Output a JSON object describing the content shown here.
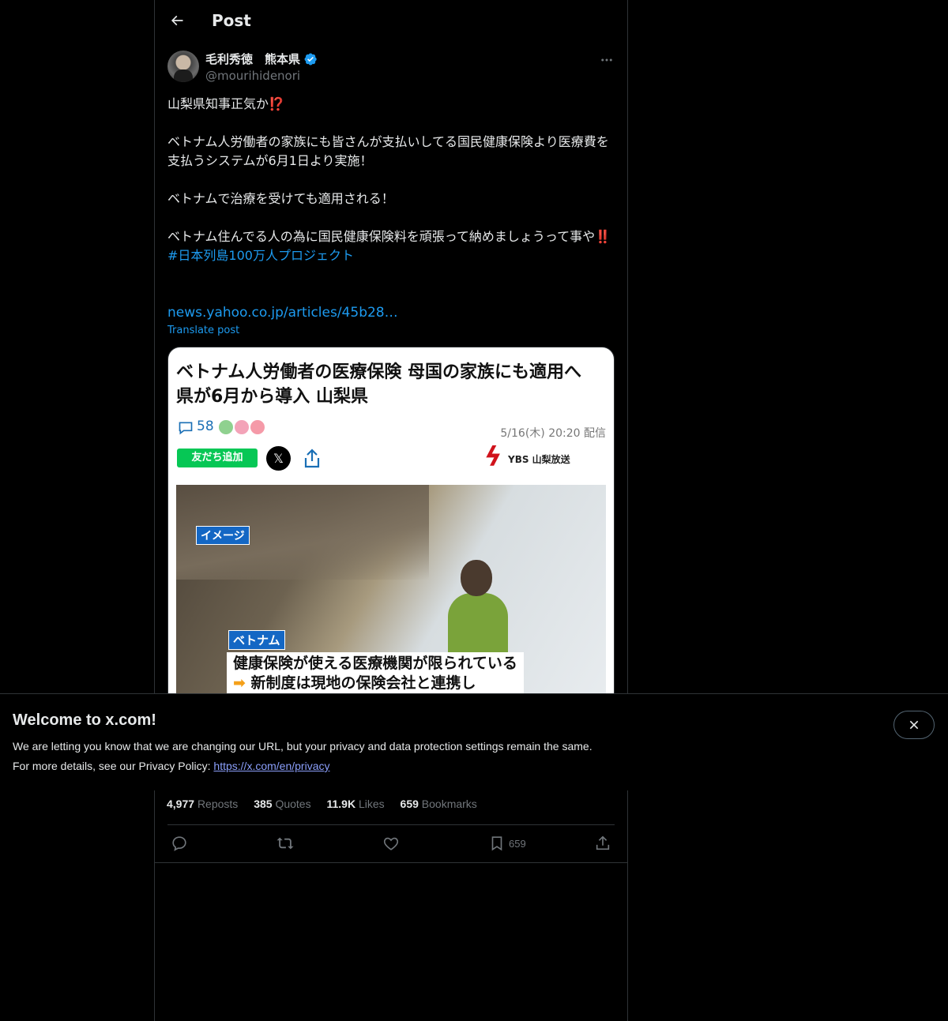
{
  "header": {
    "title": "Post"
  },
  "author": {
    "display_name": "毛利秀徳　熊本県",
    "handle": "@mourihidenori",
    "verified": true
  },
  "post": {
    "line1": "山梨県知事正気か",
    "line1_emoji": "⁉️",
    "para2": "ベトナム人労働者の家族にも皆さんが支払いしてる国民健康保険より医療費を支払うシステムが6月1日より実施！",
    "para3": "ベトナムで治療を受けても適用される！",
    "para4": "ベトナム住んでる人の為に国民健康保険料を頑張って納めましょうって事や",
    "para4_emoji": "‼️",
    "hashtag": "#日本列島100万人プロジェクト",
    "link": "news.yahoo.co.jp/articles/45b28…",
    "translate": "Translate post"
  },
  "media": {
    "headline": "ベトナム人労働者の医療保険 母国の家族にも適用へ 県が6月から導入 山梨県",
    "comment_count": "58",
    "date": "5/16(木) 20:20 配信",
    "line_button": "友だち追加",
    "x_logo": "𝕏",
    "source": "YBS 山梨放送",
    "tag_image": "イメージ",
    "tag_country": "ベトナム",
    "caption_line1": "健康保険が使える医療機関が限られている",
    "caption_line2": "新制度は現地の保険会社と連携し"
  },
  "banner": {
    "title": "Welcome to x.com!",
    "body_line1": "We are letting you know that we are changing our URL, but your privacy and data protection settings remain the same.",
    "body_line2_prefix": "For more details, see our Privacy Policy: ",
    "privacy_link": "https://x.com/en/privacy"
  },
  "stats": {
    "reposts_count": "4,977",
    "reposts_label": "Reposts",
    "quotes_count": "385",
    "quotes_label": "Quotes",
    "likes_count": "11.9K",
    "likes_label": "Likes",
    "bookmarks_count": "659",
    "bookmarks_label": "Bookmarks"
  },
  "actions": {
    "bookmark_count": "659"
  },
  "colors": {
    "accent": "#1d9bf0",
    "background": "#000000",
    "text": "#e7e9ea",
    "muted": "#71767b",
    "border": "#2f3336"
  },
  "icons": [
    "back-arrow-icon",
    "verified-badge-icon",
    "more-icon",
    "reply-icon",
    "repost-icon",
    "like-icon",
    "bookmark-icon",
    "share-icon",
    "close-icon"
  ]
}
